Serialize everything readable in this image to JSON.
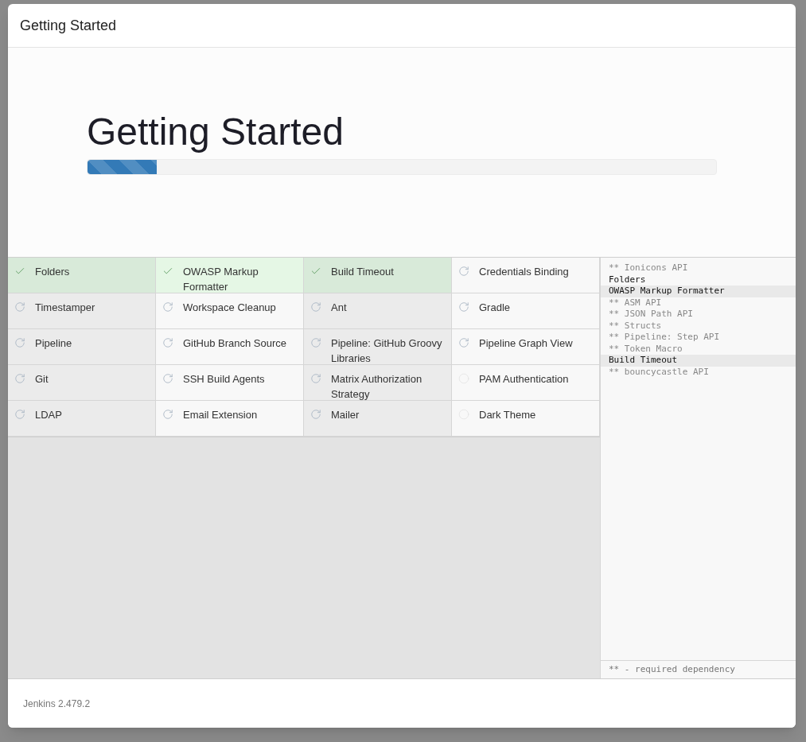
{
  "window": {
    "title": "Getting Started"
  },
  "hero": {
    "heading": "Getting Started",
    "progress": {
      "level": 0.11
    }
  },
  "plugins": [
    {
      "name": "Folders",
      "kind": "success"
    },
    {
      "name": "OWASP Markup Formatter",
      "kind": "success"
    },
    {
      "name": "Build Timeout",
      "kind": "success"
    },
    {
      "name": "Credentials Binding",
      "kind": "installing"
    },
    {
      "name": "Timestamper",
      "kind": "installing"
    },
    {
      "name": "Workspace Cleanup",
      "kind": "installing"
    },
    {
      "name": "Ant",
      "kind": "installing"
    },
    {
      "name": "Gradle",
      "kind": "installing"
    },
    {
      "name": "Pipeline",
      "kind": "installing"
    },
    {
      "name": "GitHub Branch Source",
      "kind": "installing"
    },
    {
      "name": "Pipeline: GitHub Groovy Libraries",
      "kind": "installing"
    },
    {
      "name": "Pipeline Graph View",
      "kind": "installing"
    },
    {
      "name": "Git",
      "kind": "installing"
    },
    {
      "name": "SSH Build Agents",
      "kind": "installing"
    },
    {
      "name": "Matrix Authorization Strategy",
      "kind": "installing"
    },
    {
      "name": "PAM Authentication",
      "kind": "pending"
    },
    {
      "name": "LDAP",
      "kind": "installing"
    },
    {
      "name": "Email Extension",
      "kind": "installing"
    },
    {
      "name": "Mailer",
      "kind": "installing"
    },
    {
      "name": "Dark Theme",
      "kind": "pending"
    }
  ],
  "install_log": {
    "lines": [
      {
        "text": "** Ionicons API",
        "kind": "dependency",
        "highlighted": false
      },
      {
        "text": "Folders",
        "kind": "plugin",
        "highlighted": false
      },
      {
        "text": "OWASP Markup Formatter",
        "kind": "plugin",
        "highlighted": true
      },
      {
        "text": "** ASM API",
        "kind": "dependency",
        "highlighted": false
      },
      {
        "text": "** JSON Path API",
        "kind": "dependency",
        "highlighted": false
      },
      {
        "text": "** Structs",
        "kind": "dependency",
        "highlighted": false
      },
      {
        "text": "** Pipeline: Step API",
        "kind": "dependency",
        "highlighted": false
      },
      {
        "text": "** Token Macro",
        "kind": "dependency",
        "highlighted": false
      },
      {
        "text": "Build Timeout",
        "kind": "plugin",
        "highlighted": true
      },
      {
        "text": "** bouncycastle API",
        "kind": "dependency",
        "highlighted": false
      }
    ],
    "legend": "** - required dependency"
  },
  "footer": {
    "version": "Jenkins 2.479.2"
  }
}
